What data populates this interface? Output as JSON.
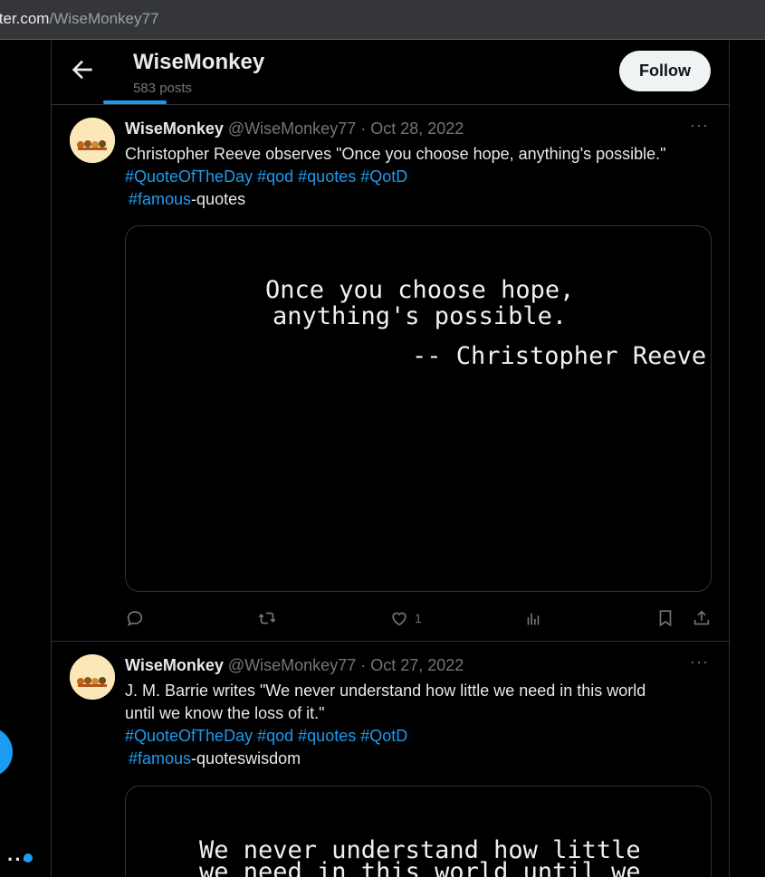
{
  "browser": {
    "url_host": "tter.com",
    "url_path": "/WiseMonkey77"
  },
  "header": {
    "name": "WiseMonkey",
    "post_count": "583 posts",
    "follow_label": "Follow"
  },
  "tweets": [
    {
      "name": "WiseMonkey",
      "handle": "@WiseMonkey77",
      "sep": "·",
      "date": "Oct 28, 2022",
      "line1": "Christopher Reeve observes  \"Once you choose hope, anything's possible.\"",
      "tags": [
        "#QuoteOfTheDay",
        "#qod",
        "#quotes",
        "#QotD"
      ],
      "tag_famous": "#famous",
      "suffix": "-quotes",
      "image_lines": [
        "Once you choose hope,",
        "anything's possible.",
        "-- Christopher Reeve"
      ],
      "like_count": "1"
    },
    {
      "name": "WiseMonkey",
      "handle": "@WiseMonkey77",
      "sep": "·",
      "date": "Oct 27, 2022",
      "line1": "J. M. Barrie writes  \"We never understand how little we need in this world",
      "line2": "until we know the loss of it.\"",
      "tags": [
        "#QuoteOfTheDay",
        "#qod",
        "#quotes",
        "#QotD"
      ],
      "tag_famous": "#famous",
      "suffix": "-quoteswisdom",
      "image_lines": [
        "We never understand how little",
        "we need in this world until we"
      ]
    }
  ],
  "colors": {
    "accent": "#1d9bf0",
    "background": "#000000",
    "text": "#e7e9ea",
    "muted": "#71767b",
    "border": "#2f3336"
  },
  "icons": {
    "back": "arrow-left-icon",
    "more": "more-horizontal-icon",
    "reply": "reply-icon",
    "retweet": "retweet-icon",
    "like": "heart-icon",
    "views": "views-chart-icon",
    "bookmark": "bookmark-icon",
    "share": "share-icon"
  }
}
